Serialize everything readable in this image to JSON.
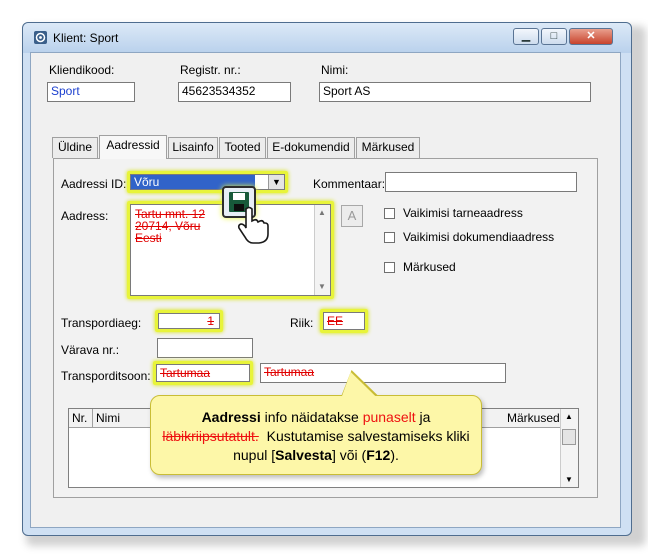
{
  "window": {
    "title": "Klient: Sport",
    "controls": {
      "minimize": "▁",
      "maximize": "□",
      "close": "✕"
    }
  },
  "header": {
    "client_code_label": "Kliendikood:",
    "client_code_value": "Sport",
    "reg_nr_label": "Registr. nr.:",
    "reg_nr_value": "45623534352",
    "name_label": "Nimi:",
    "name_value": "Sport AS"
  },
  "tabs": [
    {
      "label": "Üldine"
    },
    {
      "label": "Aadressid",
      "active": true
    },
    {
      "label": "Lisainfo"
    },
    {
      "label": "Tooted"
    },
    {
      "label": "E-dokumendid"
    },
    {
      "label": "Märkused"
    }
  ],
  "address": {
    "id_label": "Aadressi ID:",
    "id_value": "Võru",
    "comment_label": "Kommentaar:",
    "comment_value": "",
    "address_label": "Aadress:",
    "address_lines": [
      "Tartu mnt. 12",
      "20714, Võru",
      "Eesti"
    ],
    "a_button": "A",
    "checkboxes": [
      {
        "label": "Vaikimisi tarneaadress",
        "checked": false
      },
      {
        "label": "Vaikimisi dokumendiaadress",
        "checked": false
      },
      {
        "label": "Märkused",
        "checked": false
      }
    ],
    "transport_time_label": "Transpordiaeg:",
    "transport_time_value": "1",
    "country_label": "Riik:",
    "country_value": "EE",
    "gate_label": "Värava nr.:",
    "gate_value": "",
    "transport_zone_label": "Transporditsoon:",
    "transport_zone_value": "Tartumaa",
    "transport_zone_name": "Tartumaa"
  },
  "table": {
    "columns": [
      "Nr.",
      "Nimi",
      "Märkused"
    ]
  },
  "callout": {
    "part1_bold": "Aadressi",
    "part2": " info näidatakse ",
    "part3_red": "punaselt",
    "part4": " ja ",
    "part5_strike": "läbikriipsutatult.",
    "part6": "  Kustutamise salvestamiseks kliki nupul [",
    "part7_bold": "Salvesta",
    "part8": "] või (",
    "part9_bold": "F12",
    "part10": ")."
  },
  "colors": {
    "highlight": "#e8f43a",
    "deleted_text": "#e00000",
    "callout_bg": "#fdf7a8"
  }
}
